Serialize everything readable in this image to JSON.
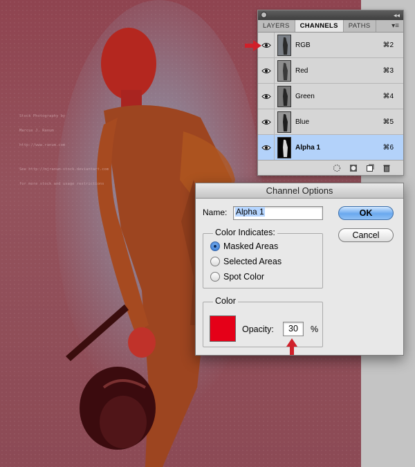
{
  "photo": {
    "credit_lines": [
      "Stock Photography by",
      "Marcus J. Ranum",
      "http://www.ranum.com",
      "",
      "See http://mjranum-stock.deviantart.com",
      "for more stock and usage restrictions"
    ]
  },
  "channels_panel": {
    "tabs": [
      "LAYERS",
      "CHANNELS",
      "PATHS"
    ],
    "active_tab": "CHANNELS",
    "collapse_glyph": "◂◂",
    "menu_glyph": "▾≡",
    "rows": [
      {
        "name": "RGB",
        "shortcut": "⌘2"
      },
      {
        "name": "Red",
        "shortcut": "⌘3"
      },
      {
        "name": "Green",
        "shortcut": "⌘4"
      },
      {
        "name": "Blue",
        "shortcut": "⌘5"
      },
      {
        "name": "Alpha 1",
        "shortcut": "⌘6",
        "selected": true
      }
    ]
  },
  "dialog": {
    "title": "Channel Options",
    "name_label": "Name:",
    "name_value": "Alpha 1",
    "color_indicates_title": "Color Indicates:",
    "options": [
      {
        "label": "Masked Areas",
        "selected": true
      },
      {
        "label": "Selected Areas",
        "selected": false
      },
      {
        "label": "Spot Color",
        "selected": false
      }
    ],
    "color_title": "Color",
    "swatch_color": "#e50018",
    "opacity_label": "Opacity:",
    "opacity_value": "30",
    "opacity_unit": "%",
    "ok_label": "OK",
    "cancel_label": "Cancel"
  },
  "colors": {
    "annotation_arrow": "#d0202a",
    "selection": "#b3d2fa"
  }
}
